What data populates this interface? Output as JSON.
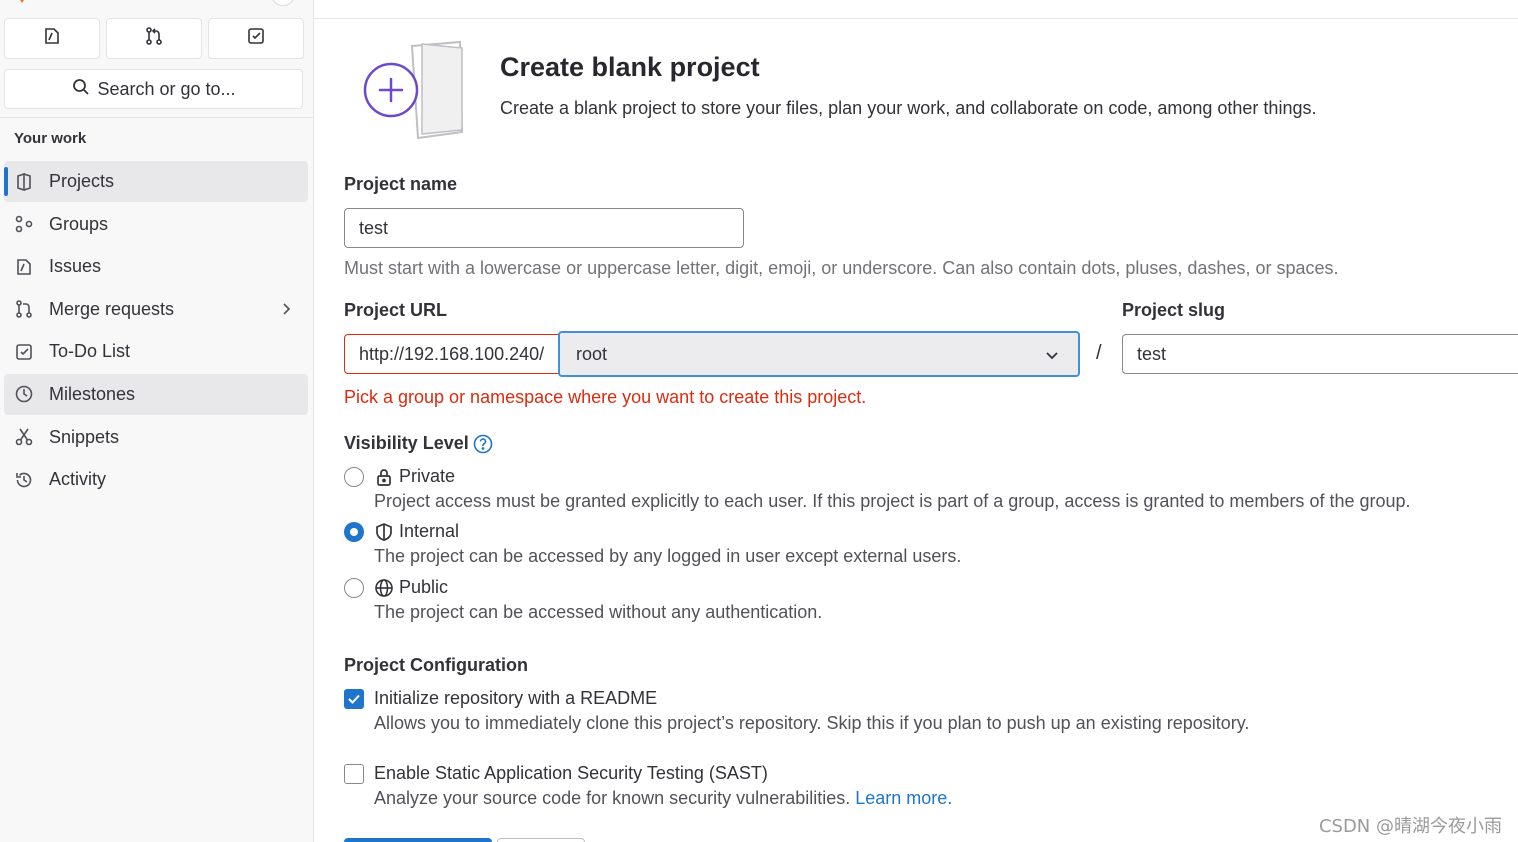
{
  "sidebar": {
    "search_label": "Search or go to...",
    "section_title": "Your work",
    "items": [
      {
        "label": "Projects"
      },
      {
        "label": "Groups"
      },
      {
        "label": "Issues"
      },
      {
        "label": "Merge requests"
      },
      {
        "label": "To-Do List"
      },
      {
        "label": "Milestones"
      },
      {
        "label": "Snippets"
      },
      {
        "label": "Activity"
      }
    ]
  },
  "page": {
    "title": "Create blank project",
    "description": "Create a blank project to store your files, plan your work, and collaborate on code, among other things."
  },
  "form": {
    "project_name_label": "Project name",
    "project_name_value": "test",
    "project_name_help": "Must start with a lowercase or uppercase letter, digit, emoji, or underscore. Can also contain dots, pluses, dashes, or spaces.",
    "project_url_label": "Project URL",
    "project_url_prefix": "http://192.168.100.240/",
    "namespace_value": "root",
    "separator": "/",
    "project_slug_label": "Project slug",
    "project_slug_value": "test",
    "namespace_error": "Pick a group or namespace where you want to create this project.",
    "visibility_label": "Visibility Level",
    "visibility": [
      {
        "label": "Private",
        "help": "Project access must be granted explicitly to each user. If this project is part of a group, access is granted to members of the group.",
        "checked": false
      },
      {
        "label": "Internal",
        "help": "The project can be accessed by any logged in user except external users.",
        "checked": true
      },
      {
        "label": "Public",
        "help": "The project can be accessed without any authentication.",
        "checked": false
      }
    ],
    "config_label": "Project Configuration",
    "readme_label": "Initialize repository with a README",
    "readme_checked": true,
    "readme_help": "Allows you to immediately clone this project’s repository. Skip this if you plan to push up an existing repository.",
    "sast_label": "Enable Static Application Security Testing (SAST)",
    "sast_checked": false,
    "sast_help": "Analyze your source code for known security vulnerabilities.",
    "sast_link": "Learn more."
  },
  "watermark": "CSDN @晴湖今夜小雨",
  "colors": {
    "accent": "#1f75cb",
    "error": "#dd2b0e",
    "illustration": "#6e49cb"
  }
}
